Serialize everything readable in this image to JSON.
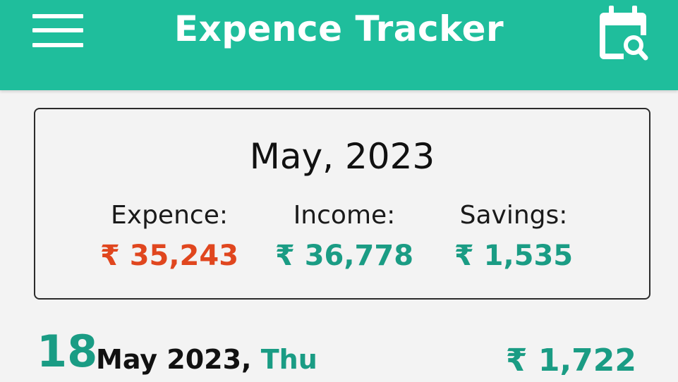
{
  "app_bar": {
    "title": "Expence Tracker",
    "background_color": "#1fbe9c",
    "menu_icon": "hamburger-menu-icon",
    "calendar_search_icon": "calendar-search-icon"
  },
  "summary": {
    "month": "May, 2023",
    "expence_label": "Expence:",
    "expence_value": "₹ 35,243",
    "income_label": "Income:",
    "income_value": "₹ 36,778",
    "savings_label": "Savings:",
    "savings_value": "₹ 1,535",
    "expence_color": "#e0461e",
    "positive_color": "#1a9c84"
  },
  "day_entry": {
    "day": "18",
    "month_year": "May 2023,",
    "weekday": "Thu",
    "total": "₹ 1,722"
  }
}
